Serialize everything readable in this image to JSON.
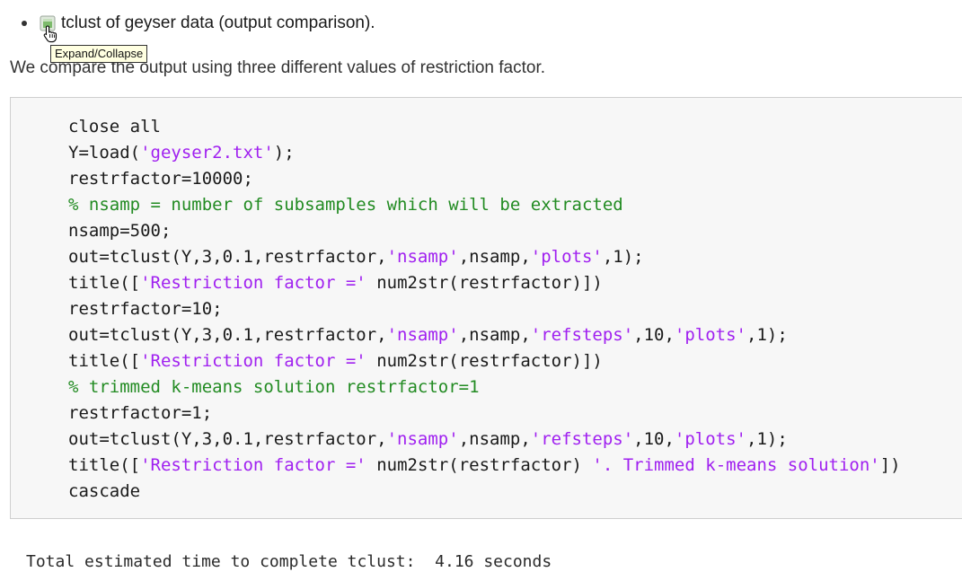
{
  "example": {
    "title": "tclust of geyser data (output comparison).",
    "tooltip": "Expand/Collapse",
    "description": "We compare the output using three different values of restriction factor.",
    "icons": {
      "bullet": "bullet-dot",
      "expand": "expand-collapse-icon",
      "cursor": "hand-pointer-cursor"
    }
  },
  "code": {
    "colors": {
      "string": "#a020f0",
      "comment": "#228b22",
      "default": "#1a1a1a"
    },
    "lines": [
      [
        {
          "t": "close all",
          "k": "n"
        }
      ],
      [
        {
          "t": "Y=load(",
          "k": "n"
        },
        {
          "t": "'geyser2.txt'",
          "k": "s"
        },
        {
          "t": ");",
          "k": "n"
        }
      ],
      [
        {
          "t": "restrfactor=10000;",
          "k": "n"
        }
      ],
      [
        {
          "t": "% nsamp = number of subsamples which will be extracted",
          "k": "c"
        }
      ],
      [
        {
          "t": "nsamp=500;",
          "k": "n"
        }
      ],
      [
        {
          "t": "out=tclust(Y,3,0.1,restrfactor,",
          "k": "n"
        },
        {
          "t": "'nsamp'",
          "k": "s"
        },
        {
          "t": ",nsamp,",
          "k": "n"
        },
        {
          "t": "'plots'",
          "k": "s"
        },
        {
          "t": ",1);",
          "k": "n"
        }
      ],
      [
        {
          "t": "title([",
          "k": "n"
        },
        {
          "t": "'Restriction factor ='",
          "k": "s"
        },
        {
          "t": " num2str(restrfactor)])",
          "k": "n"
        }
      ],
      [
        {
          "t": "restrfactor=10;",
          "k": "n"
        }
      ],
      [
        {
          "t": "out=tclust(Y,3,0.1,restrfactor,",
          "k": "n"
        },
        {
          "t": "'nsamp'",
          "k": "s"
        },
        {
          "t": ",nsamp,",
          "k": "n"
        },
        {
          "t": "'refsteps'",
          "k": "s"
        },
        {
          "t": ",10,",
          "k": "n"
        },
        {
          "t": "'plots'",
          "k": "s"
        },
        {
          "t": ",1);",
          "k": "n"
        }
      ],
      [
        {
          "t": "title([",
          "k": "n"
        },
        {
          "t": "'Restriction factor ='",
          "k": "s"
        },
        {
          "t": " num2str(restrfactor)])",
          "k": "n"
        }
      ],
      [
        {
          "t": "% trimmed k-means solution restrfactor=1",
          "k": "c"
        }
      ],
      [
        {
          "t": "restrfactor=1;",
          "k": "n"
        }
      ],
      [
        {
          "t": "out=tclust(Y,3,0.1,restrfactor,",
          "k": "n"
        },
        {
          "t": "'nsamp'",
          "k": "s"
        },
        {
          "t": ",nsamp,",
          "k": "n"
        },
        {
          "t": "'refsteps'",
          "k": "s"
        },
        {
          "t": ",10,",
          "k": "n"
        },
        {
          "t": "'plots'",
          "k": "s"
        },
        {
          "t": ",1);",
          "k": "n"
        }
      ],
      [
        {
          "t": "title([",
          "k": "n"
        },
        {
          "t": "'Restriction factor ='",
          "k": "s"
        },
        {
          "t": " num2str(restrfactor) ",
          "k": "n"
        },
        {
          "t": "'. Trimmed k-means solution'",
          "k": "s"
        },
        {
          "t": "])",
          "k": "n"
        }
      ],
      [
        {
          "t": "cascade",
          "k": "n"
        }
      ]
    ]
  },
  "output": {
    "text": "Total estimated time to complete tclust:  4.16 seconds"
  }
}
